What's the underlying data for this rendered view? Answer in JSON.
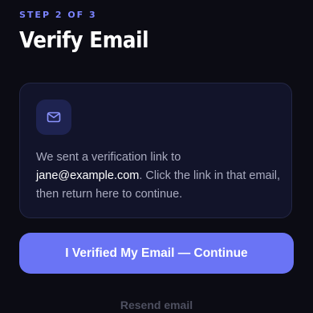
{
  "step_label": "STEP 2 OF 3",
  "title": "Verify Email",
  "card": {
    "icon": "mail-icon",
    "message_prefix": "We sent a verification link to ",
    "email": "jane@example.com",
    "message_suffix": ". Click the link in that email, then return here to continue."
  },
  "primary_button": "I Verified My Email — Continue",
  "resend_link": "Resend email",
  "colors": {
    "background": "#0c0c14",
    "accent": "#6a74f5",
    "step_label": "#7b84ff",
    "card": "#12142a",
    "card_border": "#232745",
    "icon_bg": "#1e2350",
    "muted_text": "#a9abbf",
    "resend_text": "#4e5060"
  }
}
